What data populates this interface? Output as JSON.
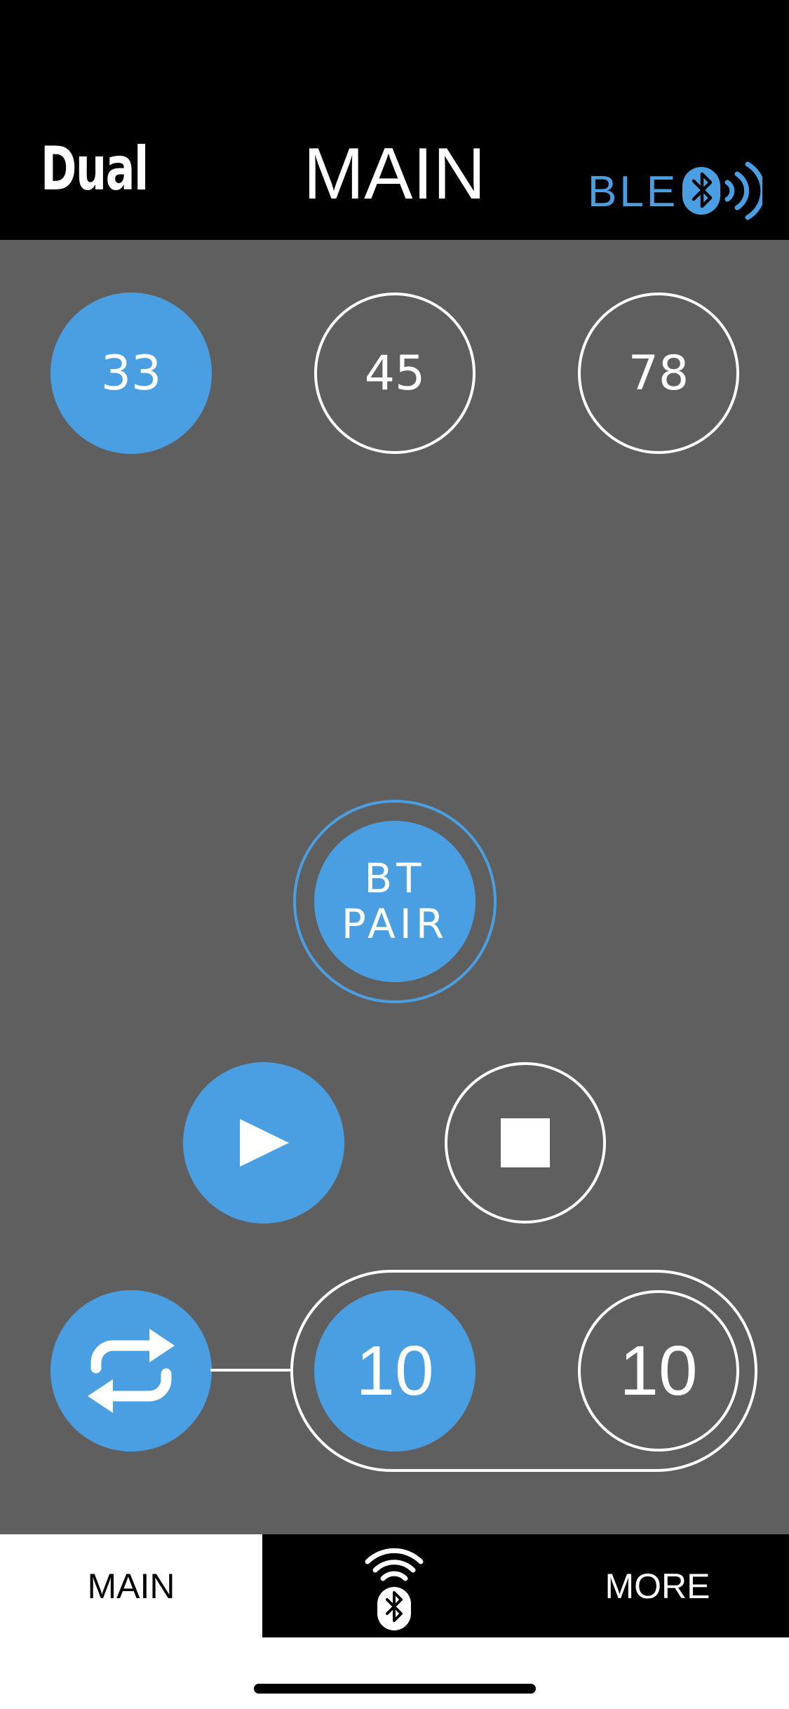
{
  "header": {
    "brand": "Dual",
    "title": "MAIN",
    "ble_label": "BLE",
    "ble_icon": "bluetooth-signal-icon"
  },
  "colors": {
    "accent": "#4a9fe3",
    "background": "#5f5f5f",
    "bar": "#000000",
    "foreground": "#ffffff"
  },
  "speeds": [
    {
      "label": "33",
      "selected": true
    },
    {
      "label": "45",
      "selected": false
    },
    {
      "label": "78",
      "selected": false
    }
  ],
  "pair_button": {
    "line1": "BT",
    "line2": "PAIR"
  },
  "controls": {
    "play_icon": "play-icon",
    "stop_icon": "stop-icon",
    "repeat_icon": "repeat-icon"
  },
  "counters": [
    {
      "value": "10",
      "selected": true
    },
    {
      "value": "10",
      "selected": false
    }
  ],
  "tabs": {
    "main_label": "MAIN",
    "bluetooth_icon": "bluetooth-wifi-icon",
    "more_label": "MORE"
  }
}
